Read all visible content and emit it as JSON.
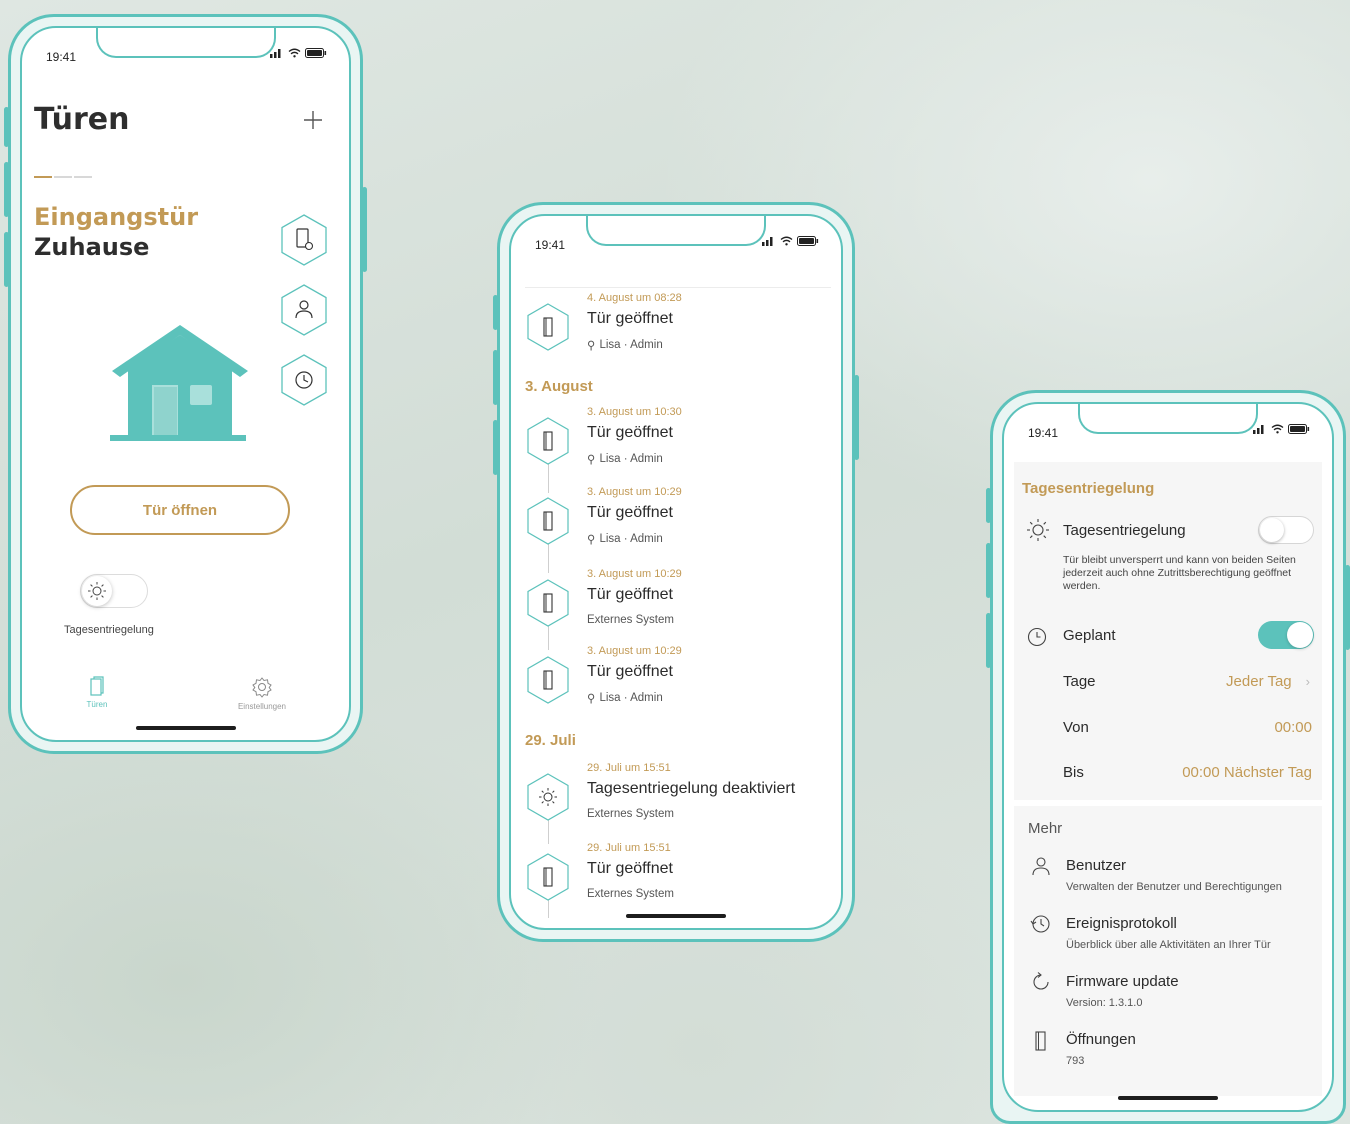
{
  "colors": {
    "accent": "#c29a56",
    "teal": "#5cc2bb",
    "background": "#dce5e0"
  },
  "status_bar": {
    "time": "19:41"
  },
  "phone1": {
    "title": "Türen",
    "add_icon": "plus-icon",
    "door_name": "Eingangstür",
    "door_location": "Zuhause",
    "side_actions": [
      "door-settings-icon",
      "user-icon",
      "history-icon"
    ],
    "open_button": "Tür öffnen",
    "day_unlock_toggle": {
      "label": "Tagesentriegelung",
      "on": false
    },
    "tabs": [
      {
        "label": "Türen",
        "icon": "door-icon",
        "active": true
      },
      {
        "label": "Einstellungen",
        "icon": "gear-icon",
        "active": false
      }
    ]
  },
  "phone2": {
    "events": [
      {
        "time": "4. August um 08:28",
        "title": "Tür geöffnet",
        "who": "Lisa · Admin",
        "icon": "door-icon"
      }
    ],
    "sections": [
      {
        "heading": "3. August",
        "events": [
          {
            "time": "3. August um 10:30",
            "title": "Tür geöffnet",
            "who": "Lisa · Admin",
            "icon": "door-icon"
          },
          {
            "time": "3. August um 10:29",
            "title": "Tür geöffnet",
            "who": "Lisa · Admin",
            "icon": "door-icon"
          },
          {
            "time": "3. August um 10:29",
            "title": "Tür geöffnet",
            "who": "Externes System",
            "icon": "door-icon"
          },
          {
            "time": "3. August um 10:29",
            "title": "Tür geöffnet",
            "who": "Lisa · Admin",
            "icon": "door-icon"
          }
        ]
      },
      {
        "heading": "29. Juli",
        "events": [
          {
            "time": "29. Juli um 15:51",
            "title": "Tagesentriegelung deaktiviert",
            "who": "Externes System",
            "icon": "sun-icon"
          },
          {
            "time": "29. Juli um 15:51",
            "title": "Tür geöffnet",
            "who": "Externes System",
            "icon": "door-icon"
          }
        ]
      }
    ]
  },
  "phone3": {
    "section_title": "Tagesentriegelung",
    "day_unlock": {
      "label": "Tagesentriegelung",
      "on": false,
      "description": "Tür bleibt unversperrt und kann von beiden Seiten jederzeit auch ohne Zutrittsberechtigung geöffnet werden."
    },
    "planned": {
      "label": "Geplant",
      "on": true
    },
    "days": {
      "label": "Tage",
      "value": "Jeder Tag"
    },
    "from": {
      "label": "Von",
      "value": "00:00"
    },
    "to": {
      "label": "Bis",
      "value": "00:00 Nächster Tag"
    },
    "more_title": "Mehr",
    "more_items": [
      {
        "title": "Benutzer",
        "subtitle": "Verwalten der Benutzer und Berechtigungen",
        "icon": "user-icon"
      },
      {
        "title": "Ereignisprotokoll",
        "subtitle": "Überblick über alle Aktivitäten an Ihrer Tür",
        "icon": "history-icon"
      },
      {
        "title": "Firmware update",
        "subtitle": "Version: 1.3.1.0",
        "icon": "refresh-icon"
      },
      {
        "title": "Öffnungen",
        "subtitle": "793",
        "icon": "door-icon"
      }
    ]
  }
}
